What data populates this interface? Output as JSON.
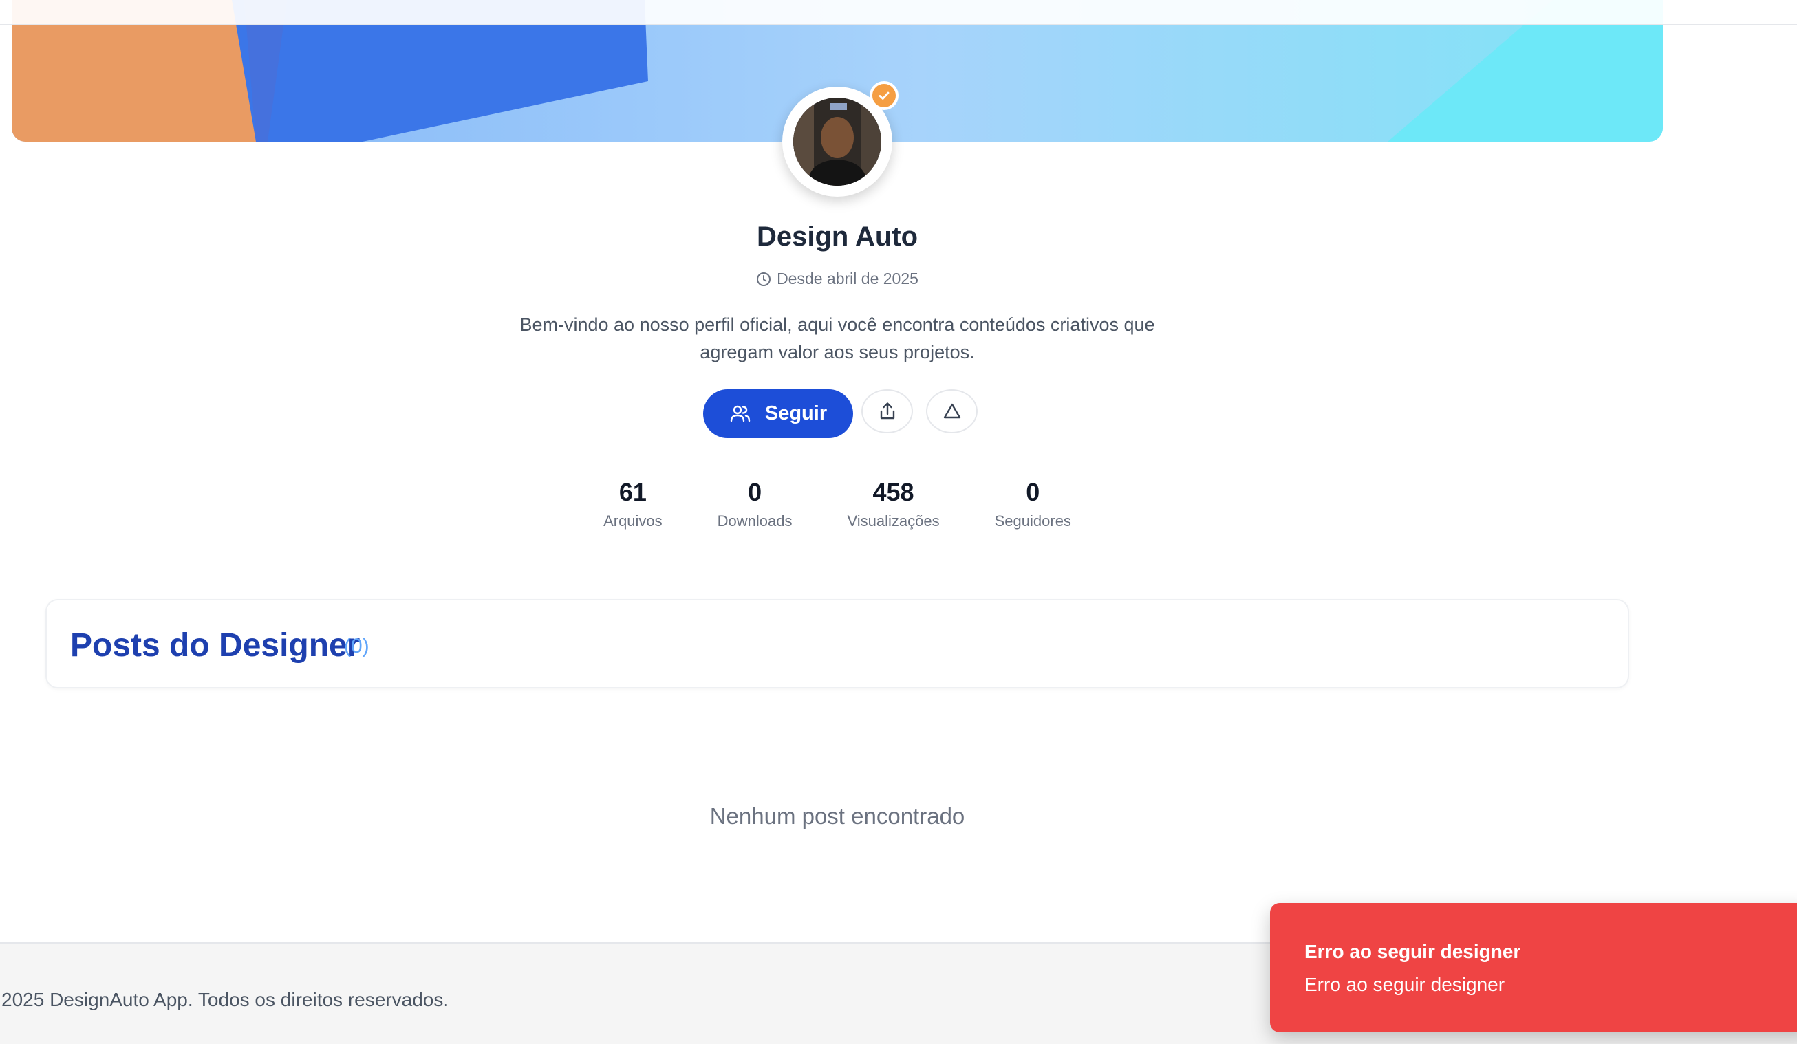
{
  "profile": {
    "name": "Design Auto",
    "since": "Desde abril de 2025",
    "bio": "Bem-vindo ao nosso perfil oficial, aqui você encontra conteúdos criativos que agregam valor aos seus projetos.",
    "verified": true
  },
  "actions": {
    "follow_label": "Seguir"
  },
  "stats": [
    {
      "value": "61",
      "label": "Arquivos"
    },
    {
      "value": "0",
      "label": "Downloads"
    },
    {
      "value": "458",
      "label": "Visualizações"
    },
    {
      "value": "0",
      "label": "Seguidores"
    }
  ],
  "posts": {
    "title": "Posts do Designer",
    "count": "(0)",
    "empty_message": "Nenhum post encontrado"
  },
  "footer": {
    "text": "2025 DesignAuto App. Todos os direitos reservados."
  },
  "toast": {
    "title": "Erro ao seguir designer",
    "description": "Erro ao seguir designer"
  },
  "colors": {
    "primary": "#1d4ed8",
    "accent": "#f59e42",
    "error": "#ef4444",
    "title_blue": "#1e40af"
  },
  "icons": {
    "since": "clock-icon",
    "follow": "users-icon",
    "share": "share-icon",
    "report": "warning-triangle-icon",
    "verified": "check-icon"
  }
}
